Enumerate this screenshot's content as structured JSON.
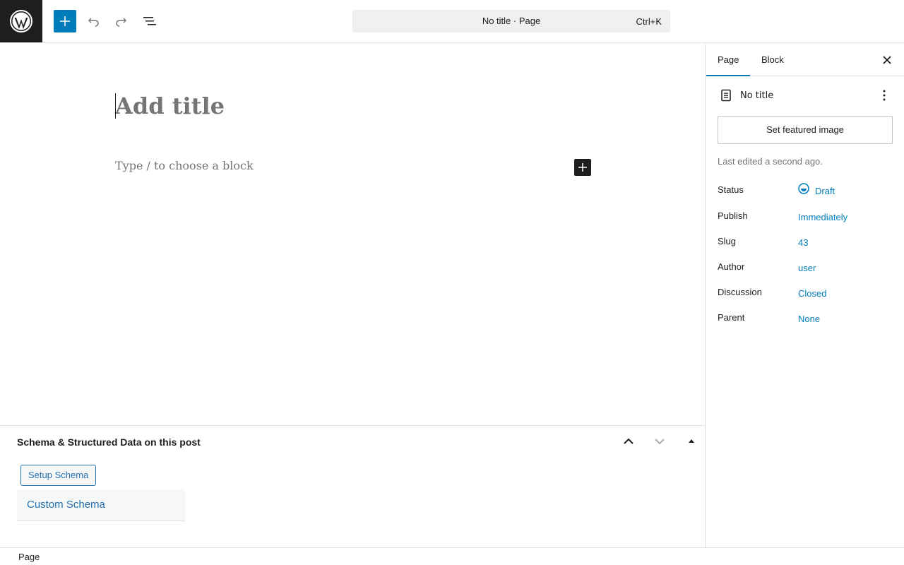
{
  "topbar": {
    "logo": "wordpress-logo",
    "add_block_icon": "plus-icon",
    "undo_icon": "undo-icon",
    "redo_icon": "redo-icon",
    "list_view_icon": "list-view-icon",
    "command_bar": {
      "title": "No title · Page",
      "shortcut": "Ctrl+K"
    }
  },
  "editor": {
    "title_placeholder": "Add title",
    "block_placeholder": "Type / to choose a block",
    "inserter_icon": "plus-icon"
  },
  "metabox": {
    "title": "Schema & Structured Data on this post",
    "setup_button": "Setup Schema",
    "custom_schema_label": "Custom Schema"
  },
  "footer": {
    "breadcrumb": "Page"
  },
  "sidebar": {
    "tabs": [
      {
        "label": "Page",
        "active": true
      },
      {
        "label": "Block",
        "active": false
      }
    ],
    "close_icon": "close-icon",
    "document": {
      "icon": "page-icon",
      "title": "No title",
      "more_icon": "more-vertical-icon"
    },
    "featured_image_button": "Set featured image",
    "last_edited": "Last edited a second ago.",
    "properties": [
      {
        "label": "Status",
        "value": "Draft",
        "icon": "draft-status-icon"
      },
      {
        "label": "Publish",
        "value": "Immediately"
      },
      {
        "label": "Slug",
        "value": "43"
      },
      {
        "label": "Author",
        "value": "user"
      },
      {
        "label": "Discussion",
        "value": "Closed"
      },
      {
        "label": "Parent",
        "value": "None"
      }
    ]
  },
  "colors": {
    "accent": "#007cba",
    "dark": "#1e1e1e",
    "link": "#2271b1",
    "placeholder": "#757575"
  }
}
